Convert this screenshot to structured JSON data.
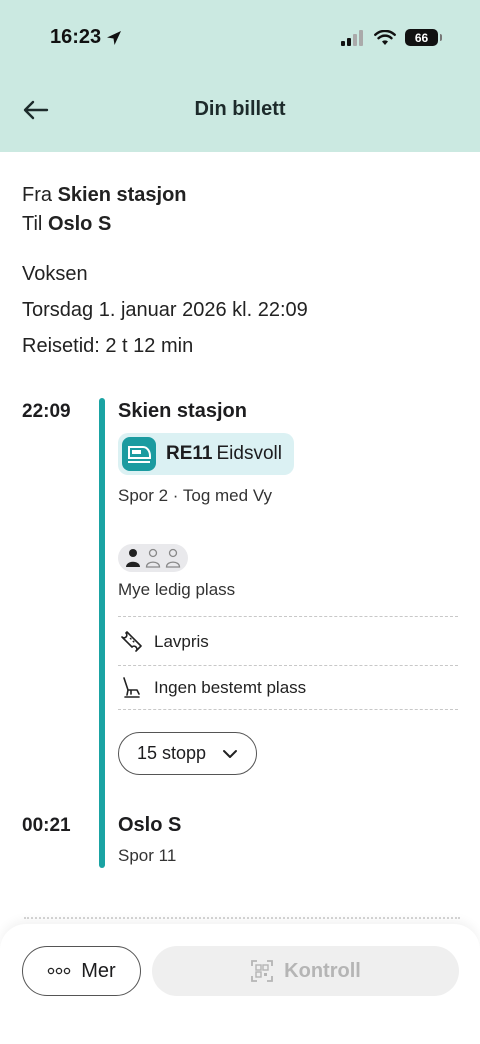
{
  "status_bar": {
    "time": "16:23",
    "battery": "66"
  },
  "nav": {
    "title": "Din billett"
  },
  "trip": {
    "from_label": "Fra",
    "from_value": "Skien stasjon",
    "to_label": "Til",
    "to_value": "Oslo S",
    "passenger": "Voksen",
    "date_time": "Torsdag 1. januar 2026 kl. 22:09",
    "travel_time": "Reisetid: 2 t 12 min"
  },
  "departure": {
    "time": "22:09",
    "station": "Skien stasjon",
    "line_code": "RE11",
    "line_destination": "Eidsvoll",
    "platform_operator": "Spor 2 · Tog med Vy",
    "crowding_text": "Mye ledig plass",
    "crowding_level": "1 of 3",
    "ticket_type": "Lavpris",
    "seat": "Ingen bestemt plass",
    "stops_button": "15 stopp"
  },
  "arrival": {
    "time": "00:21",
    "station": "Oslo S",
    "platform": "Spor 11"
  },
  "bottom": {
    "more_label": "Mer",
    "control_label": "Kontroll"
  },
  "colors": {
    "header_bg": "#cbe9e1",
    "accent": "#1aa3a3",
    "badge_bg": "#dbf1f3"
  },
  "icons": {
    "back": "arrow-left-icon",
    "location": "location-arrow-icon",
    "train": "train-icon",
    "crowd": "person-icon",
    "ticket": "ticket-icon",
    "seat": "seat-icon",
    "chevron": "chevron-down-icon",
    "more": "dots-icon",
    "qr": "qr-code-icon"
  }
}
